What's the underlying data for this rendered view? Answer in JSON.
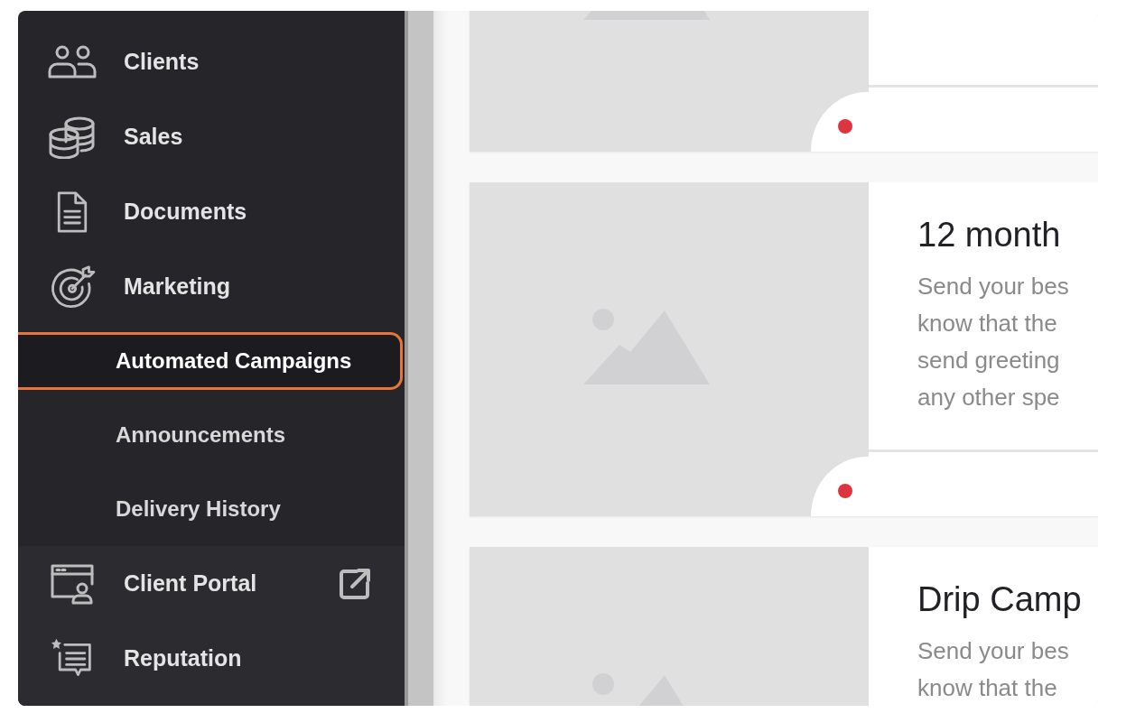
{
  "sidebar": {
    "items": [
      {
        "kind": "main",
        "label": "Clients",
        "selected": false
      },
      {
        "kind": "main",
        "label": "Sales",
        "selected": false
      },
      {
        "kind": "main",
        "label": "Documents",
        "selected": false
      },
      {
        "kind": "main",
        "label": "Marketing",
        "selected": false
      },
      {
        "kind": "sub",
        "label": "Automated Campaigns",
        "selected": true
      },
      {
        "kind": "sub",
        "label": "Announcements",
        "selected": false
      },
      {
        "kind": "sub",
        "label": "Delivery History",
        "selected": false
      }
    ],
    "footer_items": [
      {
        "label": "Client Portal",
        "selected": false,
        "external": true
      },
      {
        "label": "Reputation",
        "selected": false,
        "external": false
      }
    ]
  },
  "campaigns": [
    {
      "image": {
        "kind": "picture"
      },
      "status_dot": true
    },
    {
      "image": {
        "kind": "picture"
      },
      "status_dot": true,
      "title": "12 month",
      "description": [
        "Send your bes",
        "know that the",
        "send greeting",
        "any other spe"
      ]
    },
    {
      "image": {
        "kind": "picture"
      },
      "title": "Drip Camp",
      "description": [
        "Send your bes",
        "know that the"
      ]
    }
  ]
}
